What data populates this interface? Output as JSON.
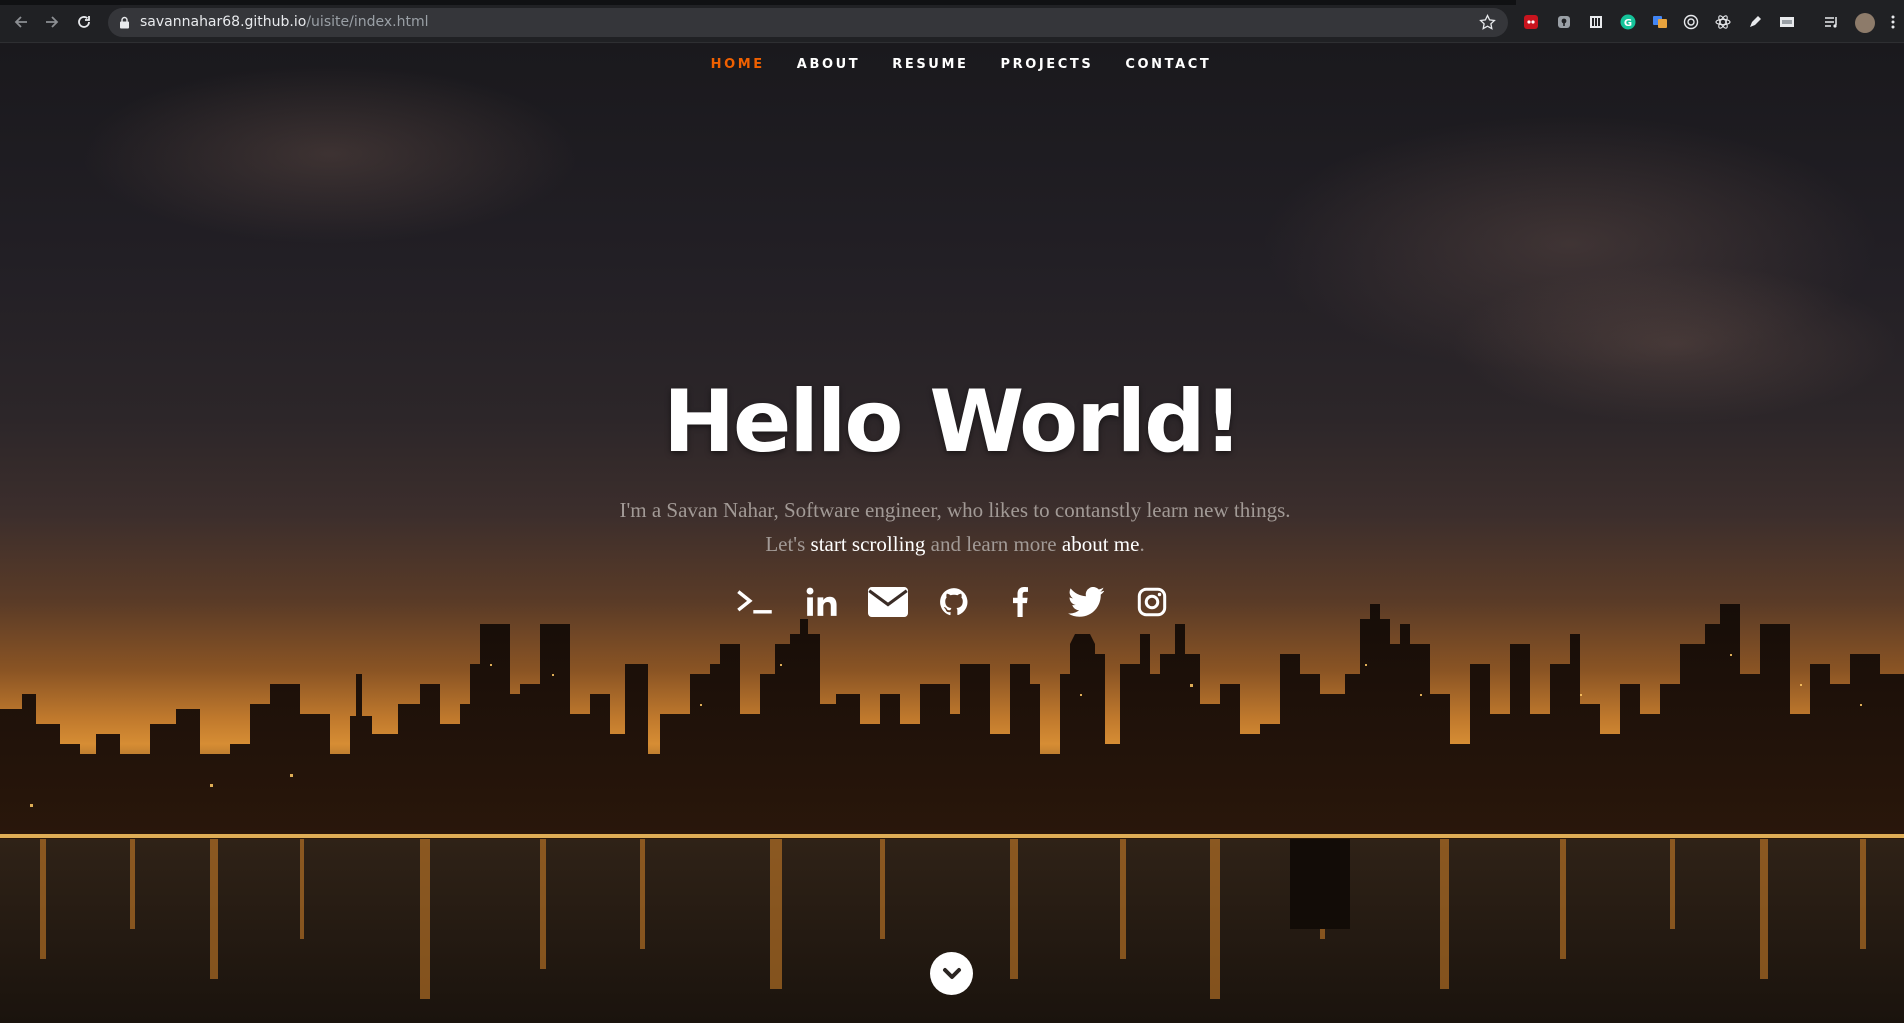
{
  "browser": {
    "url_host": "savannahar68.github.io",
    "url_path": "/uisite/index.html",
    "extensions": [
      "lastpass-icon",
      "location-icon",
      "library-icon",
      "grammarly-icon",
      "google-translate-icon",
      "target-icon",
      "react-devtools-icon",
      "pen-icon",
      "ng-icon",
      "reading-list-icon",
      "profile-avatar"
    ]
  },
  "site_nav": {
    "items": [
      {
        "label": "HOME",
        "active": true
      },
      {
        "label": "ABOUT",
        "active": false
      },
      {
        "label": "RESUME",
        "active": false
      },
      {
        "label": "PROJECTS",
        "active": false
      },
      {
        "label": "CONTACT",
        "active": false
      }
    ]
  },
  "hero": {
    "headline": "Hello World!",
    "intro_part1": "I'm a Savan Nahar, Software engineer, who likes to contanstly learn new things. Let's ",
    "intro_link1": "start scrolling",
    "intro_part2": " and learn more ",
    "intro_link2": "about me",
    "intro_part3": "."
  },
  "social": [
    "terminal-icon",
    "linkedin-icon",
    "email-icon",
    "github-icon",
    "facebook-icon",
    "twitter-icon",
    "instagram-icon"
  ],
  "colors": {
    "nav_active": "#f06000",
    "chrome_bg": "#202124",
    "omnibox_bg": "#35363a"
  }
}
